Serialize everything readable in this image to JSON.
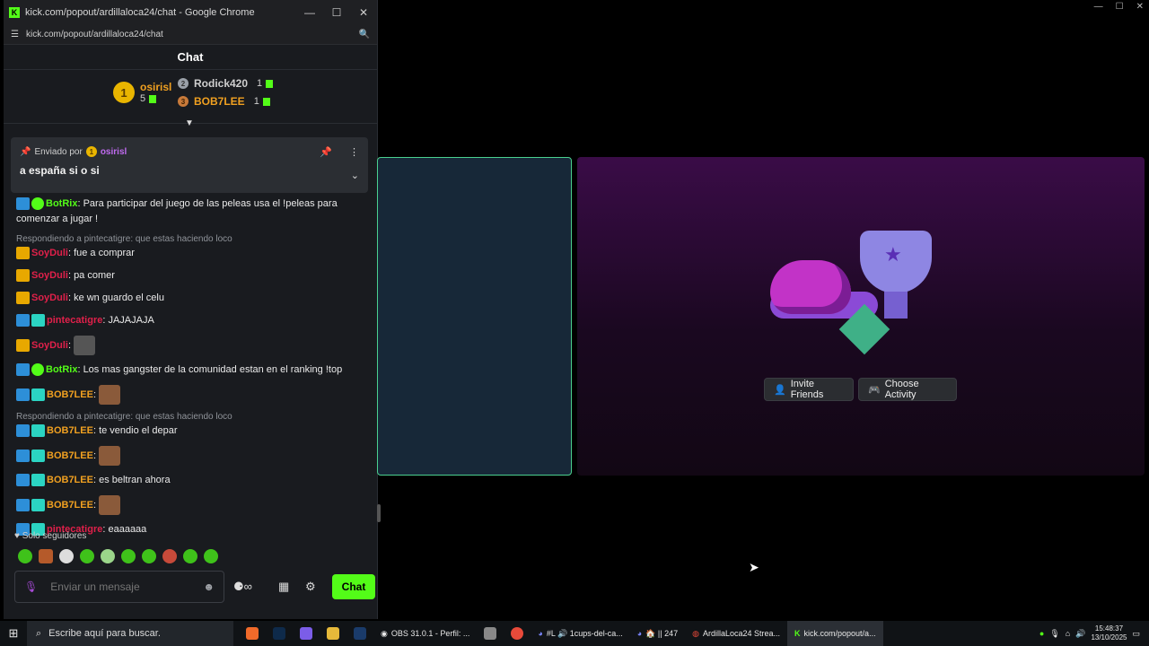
{
  "window": {
    "title": "kick.com/popout/ardillaloca24/chat - Google Chrome",
    "url": "kick.com/popout/ardillaloca24/chat"
  },
  "chat": {
    "header": "Chat",
    "leaderboard": {
      "first": {
        "rank": "1",
        "name": "osirisl",
        "count": "5"
      },
      "second": {
        "rank": "2",
        "name": "Rodick420",
        "count": "1"
      },
      "third": {
        "rank": "3",
        "name": "BOB7LEE",
        "count": "1"
      }
    },
    "pinned": {
      "label": "Enviado por",
      "by_rank": "1",
      "by": "osirisl",
      "message": "a españa si o si"
    },
    "messages": [
      {
        "type": "bot",
        "user": "BotRix",
        "color": "#53fc18",
        "text": ": Para participar del juego de las peleas usa el !peleas para comenzar a jugar !"
      },
      {
        "type": "reply",
        "text": "Respondiendo a pintecatigre: que estas haciendo loco"
      },
      {
        "type": "crown",
        "user": "SoyDuli",
        "color": "#e0204a",
        "text": ": fue a comprar"
      },
      {
        "type": "crown",
        "user": "SoyDuli",
        "color": "#e0204a",
        "text": ": pa comer"
      },
      {
        "type": "crown",
        "user": "SoyDuli",
        "color": "#e0204a",
        "text": ": ke wn guardo el celu"
      },
      {
        "type": "modsub",
        "user": "pintecatigre",
        "color": "#e0204a",
        "text": ": JAJAJAJA"
      },
      {
        "type": "crown_emote",
        "user": "SoyDuli",
        "color": "#e0204a",
        "text": ":"
      },
      {
        "type": "bot",
        "user": "BotRix",
        "color": "#53fc18",
        "text": ": Los mas gangster de la comunidad estan en el ranking !top"
      },
      {
        "type": "modsub_emote",
        "user": "BOB7LEE",
        "color": "#f0a020",
        "text": ":"
      },
      {
        "type": "reply",
        "text": "Respondiendo a pintecatigre: que estas haciendo loco"
      },
      {
        "type": "modsub",
        "user": "BOB7LEE",
        "color": "#f0a020",
        "text": ": te vendio el depar"
      },
      {
        "type": "modsub_emote",
        "user": "BOB7LEE",
        "color": "#f0a020",
        "text": ":"
      },
      {
        "type": "modsub",
        "user": "BOB7LEE",
        "color": "#f0a020",
        "text": ": es beltran ahora"
      },
      {
        "type": "modsub_emote",
        "user": "BOB7LEE",
        "color": "#f0a020",
        "text": ":"
      },
      {
        "type": "modsub",
        "user": "pintecatigre",
        "color": "#e0204a",
        "text": ": eaaaaaa"
      }
    ],
    "follow_only": "Solo seguidores",
    "input_placeholder": "Enviar un mensaje",
    "send_label": "Chat"
  },
  "activity": {
    "invite_label": "Invite Friends",
    "choose_label": "Choose Activity"
  },
  "taskbar": {
    "search_placeholder": "Escribe aquí para buscar.",
    "apps": [
      {
        "label": "OBS 31.0.1 - Perfil: ..."
      },
      {
        "label": "#L 🔊 1cups-del-ca..."
      },
      {
        "label": "🏠 || 247"
      },
      {
        "label": "ArdillaLoca24 Strea..."
      },
      {
        "label": "kick.com/popout/a..."
      }
    ],
    "time": "15:48:37",
    "date": "13/10/2025"
  }
}
